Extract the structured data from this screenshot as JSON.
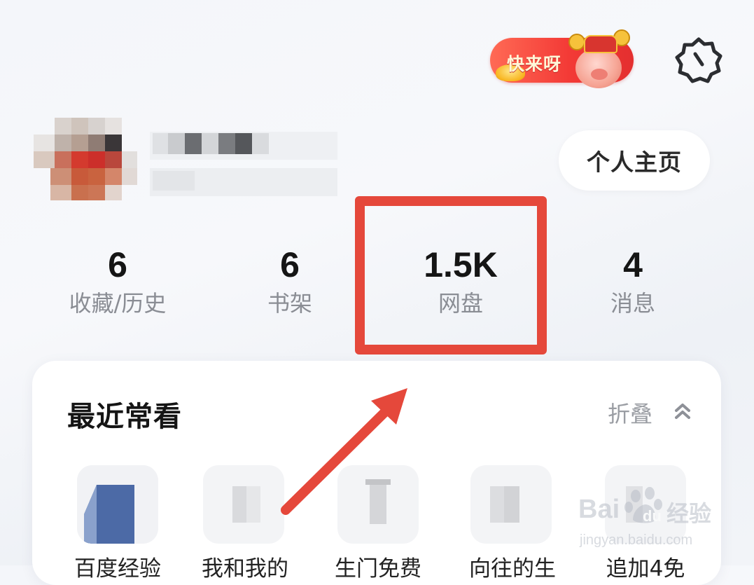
{
  "header": {
    "promo_label": "快来呀",
    "settings_icon": "gear-icon"
  },
  "profile": {
    "homepage_button": "个人主页"
  },
  "stats": [
    {
      "value": "6",
      "label": "收藏/历史"
    },
    {
      "value": "6",
      "label": "书架"
    },
    {
      "value": "1.5K",
      "label": "网盘"
    },
    {
      "value": "4",
      "label": "消息"
    }
  ],
  "recent": {
    "title": "最近常看",
    "fold_label": "折叠",
    "items": [
      {
        "label": "百度经验"
      },
      {
        "label": "我和我的"
      },
      {
        "label": "生门免费"
      },
      {
        "label": "向往的生"
      },
      {
        "label": "追加4免"
      }
    ]
  },
  "watermark": {
    "brand": "Bai",
    "brand_suffix": "du",
    "name": "经验",
    "url": "jingyan.baidu.com"
  },
  "colors": {
    "highlight": "#e5483b",
    "arrow": "#e5483b",
    "promo": "#f33a36"
  }
}
